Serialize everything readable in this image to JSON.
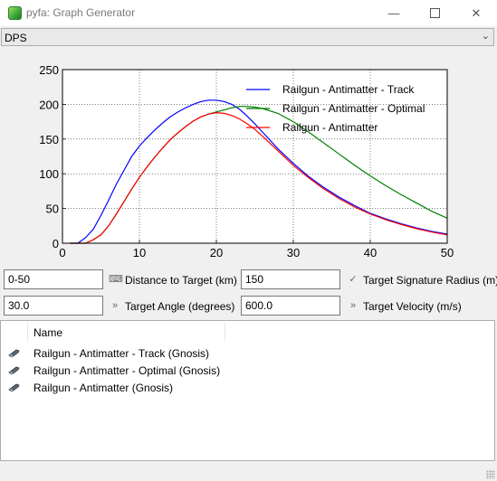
{
  "window": {
    "title": "pyfa: Graph Generator"
  },
  "graph_select": {
    "value": "DPS"
  },
  "chart_data": {
    "type": "line",
    "xlim": [
      0,
      50
    ],
    "ylim": [
      0,
      250
    ],
    "xticks": [
      "0",
      "10",
      "20",
      "30",
      "40",
      "50"
    ],
    "yticks": [
      "0",
      "50",
      "100",
      "150",
      "200",
      "250"
    ],
    "grid": true,
    "legend_position": "top-right",
    "series": [
      {
        "name": "Railgun - Antimatter - Track",
        "color": "#0000ff",
        "x": [
          1,
          2,
          3,
          4,
          5,
          6,
          7,
          8,
          9,
          10,
          11,
          12,
          13,
          14,
          15,
          16,
          17,
          18,
          19,
          20,
          21,
          22,
          23,
          24,
          25,
          26,
          28,
          30,
          32,
          34,
          36,
          38,
          40,
          42,
          44,
          46,
          48,
          50
        ],
        "y": [
          0,
          0,
          8,
          20,
          40,
          62,
          85,
          105,
          125,
          140,
          152,
          163,
          173,
          182,
          189,
          195,
          200,
          204,
          206,
          206,
          204,
          200,
          193,
          183,
          172,
          160,
          136,
          115,
          96,
          80,
          66,
          54,
          43,
          35,
          28,
          22,
          17,
          13
        ]
      },
      {
        "name": "Railgun - Antimatter - Optimal",
        "color": "#008000",
        "x": [
          1,
          2,
          3,
          4,
          5,
          6,
          7,
          8,
          9,
          10,
          11,
          12,
          13,
          14,
          15,
          16,
          17,
          18,
          19,
          20,
          21,
          22,
          23,
          24,
          25,
          26,
          28,
          30,
          32,
          34,
          36,
          38,
          40,
          42,
          44,
          46,
          48,
          50
        ],
        "y": [
          0,
          0,
          0,
          5,
          12,
          25,
          42,
          60,
          78,
          95,
          110,
          124,
          137,
          149,
          159,
          168,
          176,
          182,
          186,
          189,
          192,
          195,
          197,
          197,
          196,
          194,
          187,
          175,
          160,
          144,
          128,
          112,
          97,
          83,
          70,
          58,
          46,
          36
        ]
      },
      {
        "name": "Railgun - Antimatter",
        "color": "#ff0000",
        "x": [
          1,
          2,
          3,
          4,
          5,
          6,
          7,
          8,
          9,
          10,
          11,
          12,
          13,
          14,
          15,
          16,
          17,
          18,
          19,
          20,
          21,
          22,
          23,
          24,
          25,
          26,
          28,
          30,
          32,
          34,
          36,
          38,
          40,
          42,
          44,
          46,
          48,
          50
        ],
        "y": [
          0,
          0,
          0,
          5,
          12,
          25,
          42,
          60,
          78,
          95,
          110,
          124,
          137,
          149,
          159,
          168,
          176,
          182,
          186,
          188,
          187,
          184,
          179,
          172,
          164,
          154,
          133,
          112,
          94,
          78,
          64,
          52,
          42,
          34,
          27,
          21,
          16,
          12
        ]
      }
    ]
  },
  "inputs": {
    "distance": {
      "value": "0-50",
      "label": "Distance to Target (km)"
    },
    "signature": {
      "value": "150",
      "label": "Target Signature Radius (m)"
    },
    "angle": {
      "value": "30.0",
      "label": "Target Angle (degrees)"
    },
    "velocity": {
      "value": "600.0",
      "label": "Target Velocity (m/s)"
    }
  },
  "list": {
    "column_header": "Name",
    "items": [
      {
        "label": "Railgun - Antimatter - Track (Gnosis)",
        "icon": "railgun-icon"
      },
      {
        "label": "Railgun - Antimatter - Optimal (Gnosis)",
        "icon": "railgun-icon"
      },
      {
        "label": "Railgun - Antimatter (Gnosis)",
        "icon": "railgun-icon"
      }
    ]
  }
}
